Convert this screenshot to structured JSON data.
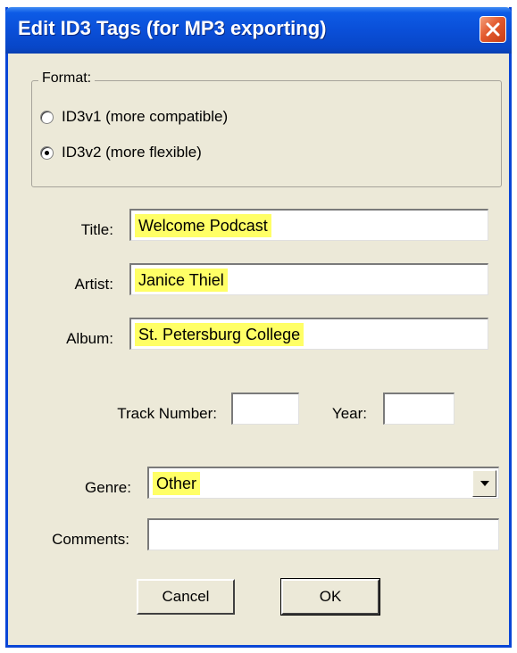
{
  "window": {
    "title": "Edit ID3 Tags (for MP3 exporting)"
  },
  "format": {
    "legend": "Format:",
    "options": [
      {
        "label": "ID3v1 (more compatible)",
        "checked": false
      },
      {
        "label": "ID3v2 (more flexible)",
        "checked": true
      }
    ]
  },
  "fields": {
    "title_label": "Title:",
    "title_value": "Welcome Podcast",
    "artist_label": "Artist:",
    "artist_value": "Janice Thiel",
    "album_label": "Album:",
    "album_value": "St. Petersburg College",
    "track_label": "Track Number:",
    "track_value": "",
    "year_label": "Year:",
    "year_value": "",
    "genre_label": "Genre:",
    "genre_value": "Other",
    "comments_label": "Comments:",
    "comments_value": ""
  },
  "buttons": {
    "cancel": "Cancel",
    "ok": "OK"
  },
  "colors": {
    "titlebar": "#0a4fd8",
    "highlight": "#ffff66",
    "dialog_bg": "#ece9d8"
  }
}
